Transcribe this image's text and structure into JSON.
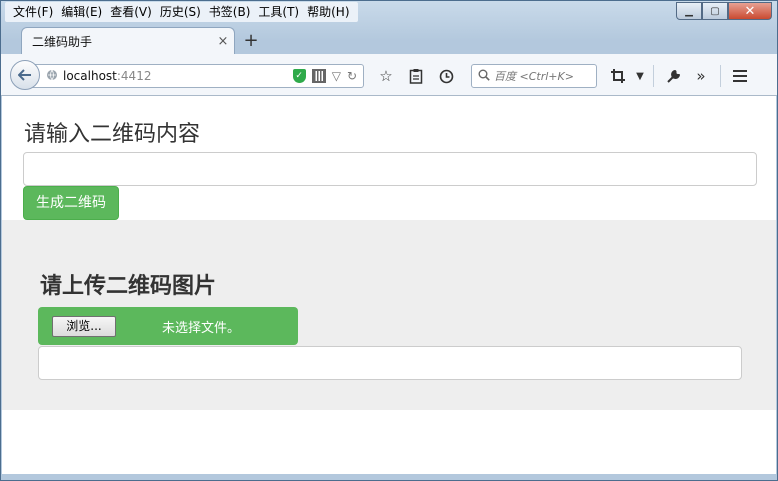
{
  "menubar": {
    "items": [
      "文件(F)",
      "编辑(E)",
      "查看(V)",
      "历史(S)",
      "书签(B)",
      "工具(T)",
      "帮助(H)"
    ]
  },
  "window_controls": {
    "minimize": "▁",
    "maximize": "▢",
    "close": "✕"
  },
  "tab": {
    "title": "二维码助手",
    "close_glyph": "×",
    "new_tab_glyph": "+"
  },
  "navbar": {
    "url_host": "localhost",
    "url_port": ":4412",
    "search_placeholder": "百度 <Ctrl+K>"
  },
  "icons": {
    "back": "arrow-left-icon",
    "site": "globe-icon",
    "shield": "shield-check-icon",
    "qr": "qr-code-icon",
    "dropdown": "triangle-down-icon",
    "reload": "reload-icon",
    "bookmark": "star-icon",
    "reading": "clipboard-icon",
    "history": "clock-icon",
    "search": "search-icon",
    "crop": "crop-icon",
    "menu_arrow": "chevron-down-icon",
    "tools": "wrench-icon",
    "overflow": "double-chevron-right-icon",
    "hamburger": "hamburger-menu-icon"
  },
  "generate": {
    "heading": "请输入二维码内容",
    "input_value": "",
    "button_label": "生成二维码"
  },
  "upload": {
    "heading": "请上传二维码图片",
    "browse_label": "浏览...",
    "file_status": "未选择文件。",
    "output_value": ""
  },
  "colors": {
    "primary_green": "#5cb85c",
    "section_gray": "#eeeeee"
  }
}
